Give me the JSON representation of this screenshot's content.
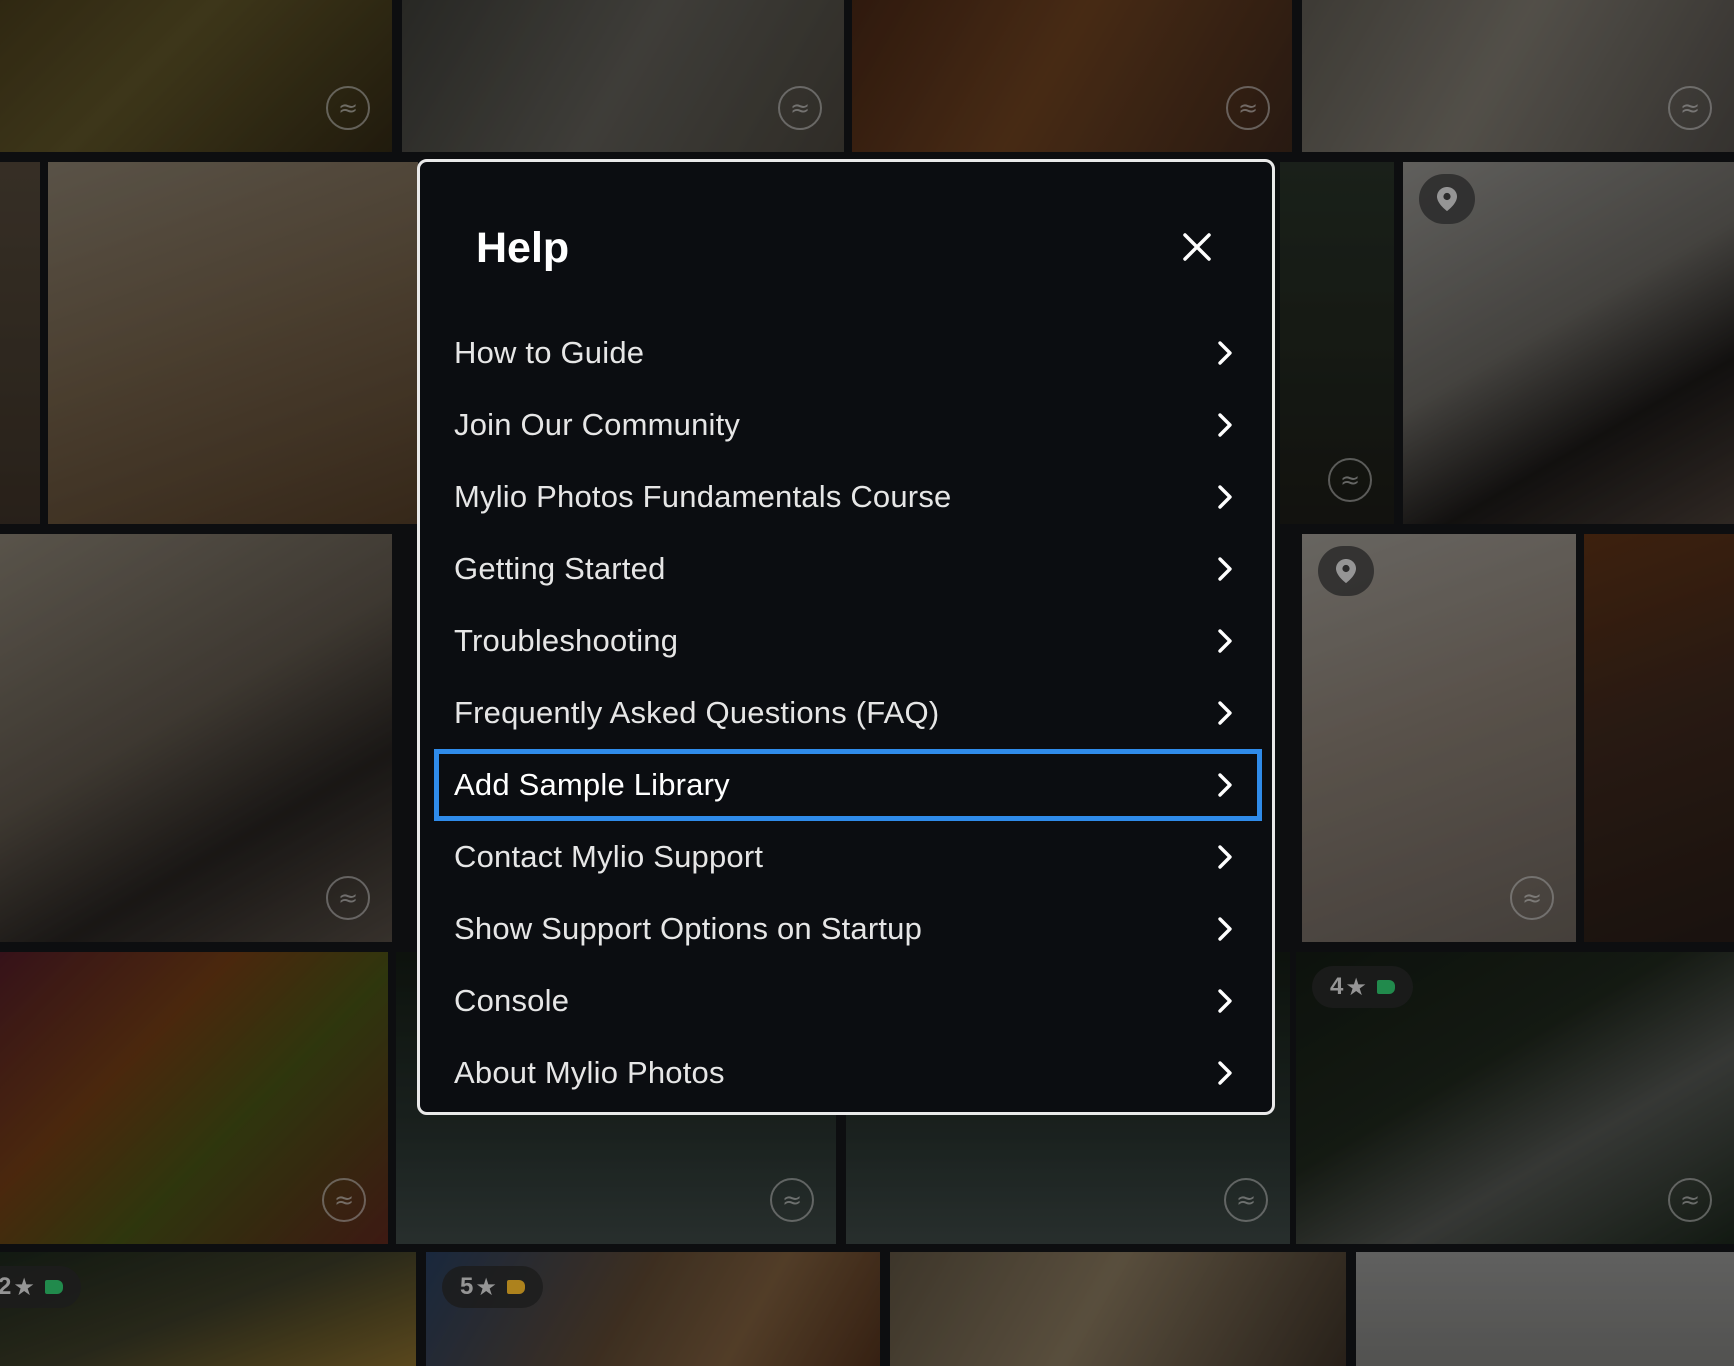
{
  "background_grid": {
    "badges": {
      "live_symbol": "≈",
      "star_symbol": "★",
      "ratings": [
        "4",
        "2",
        "5"
      ],
      "tag_colors": [
        "#2fbf6a",
        "#2fbf6a",
        "#f0b429"
      ]
    }
  },
  "dialog": {
    "title": "Help",
    "close_icon": "close-icon",
    "items": [
      {
        "label": "How to Guide"
      },
      {
        "label": "Join Our Community"
      },
      {
        "label": "Mylio Photos Fundamentals Course"
      },
      {
        "label": "Getting Started"
      },
      {
        "label": "Troubleshooting"
      },
      {
        "label": "Frequently Asked Questions (FAQ)"
      },
      {
        "label": "Add Sample Library",
        "selected": true
      },
      {
        "label": "Contact Mylio Support"
      },
      {
        "label": "Show Support Options on Startup"
      },
      {
        "label": "Console"
      },
      {
        "label": "About Mylio Photos"
      }
    ],
    "item_icon": "chevron-right-icon"
  },
  "colors": {
    "focus_outline": "#2f8bea",
    "dialog_background": "#0b0d11",
    "dialog_border": "#e9e9e9"
  }
}
